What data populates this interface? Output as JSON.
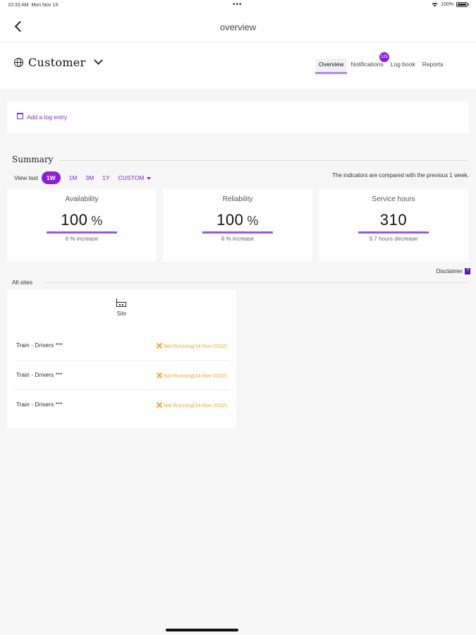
{
  "status_bar": {
    "time": "10:33 AM",
    "date": "Mon Nov 14",
    "dots": "•••",
    "battery": "100%"
  },
  "nav": {
    "title": "overview",
    "back_icon": "chevron-left-icon"
  },
  "header": {
    "customer_name": "Customer",
    "globe_icon": "globe-icon",
    "dropdown_icon": "chevron-down-icon",
    "tabs": [
      {
        "label": "Overview",
        "active": true
      },
      {
        "label": "Notifications",
        "badge": "125"
      },
      {
        "label": "Log book"
      },
      {
        "label": "Reports"
      }
    ]
  },
  "log_entry": {
    "label": "Add a log entry",
    "icon": "calendar-icon"
  },
  "summary": {
    "title": "Summary",
    "view_last_label": "View last",
    "ranges": [
      "1W",
      "1M",
      "3M",
      "1Y",
      "CUSTOM"
    ],
    "active_range": "1W",
    "compare_note": "The indicators are compared with the previous 1 week.",
    "kpis": [
      {
        "name": "Availability",
        "value": "100",
        "unit": "%",
        "delta": "6 % increase"
      },
      {
        "name": "Reliability",
        "value": "100",
        "unit": "%",
        "delta": "6 % increase"
      },
      {
        "name": "Service hours",
        "value": "310",
        "unit": "",
        "delta": "9.7 hours decrease"
      }
    ],
    "disclaimer": "Disclaimer",
    "disclaimer_icon": "info-icon"
  },
  "all_sites": {
    "title": "All sites",
    "card": {
      "icon": "site-building-icon",
      "label": "Site",
      "rows": [
        {
          "name": "Train - Drivers ***",
          "status": "Not Running(14-Nov-2022)"
        },
        {
          "name": "Train - Drivers ***",
          "status": "Not Running(14-Nov-2022)"
        },
        {
          "name": "Train - Drivers ***",
          "status": "Not Running(14-Nov-2022)"
        }
      ]
    }
  },
  "colors": {
    "accent": "#8a1fd8",
    "warning": "#f0a32c",
    "background": "#f6f6f6"
  }
}
